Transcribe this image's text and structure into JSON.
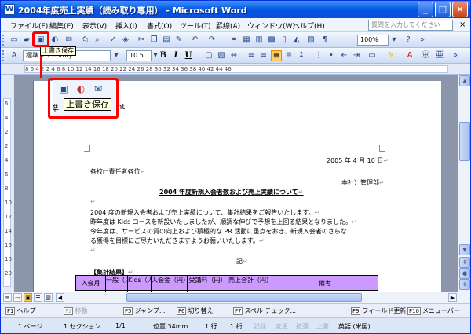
{
  "window": {
    "title": "2004年度売上実績（読み取り専用） - Microsoft Word",
    "minimize": "_",
    "maximize": "□",
    "close": "×"
  },
  "menubar": {
    "items": [
      "ファイル(F)",
      "編集(E)",
      "表示(V)",
      "挿入(I)",
      "書式(O)",
      "ツール(T)",
      "罫線(A)",
      "ウィンドウ(W)",
      "ヘルプ(H)"
    ],
    "help_placeholder": "質問を入力してください",
    "close": "×"
  },
  "toolbar_standard": {
    "zoom": "100%",
    "tooltip": "上書き保存"
  },
  "toolbar_format": {
    "style": "標準 + Century",
    "font_size": "10.5",
    "bold": "B",
    "italic": "I",
    "underline": "U"
  },
  "ruler": {
    "ticks": "8   6   4   2       2   4   6   8   10   12   14   16   18   20   22   24   26   28   30   32   34   36   38   40   42   44   46"
  },
  "vruler": {
    "ticks": [
      "6",
      "4",
      "2",
      "2",
      "4",
      "6",
      "8",
      "10",
      "12",
      "14",
      "16",
      "18",
      "20"
    ]
  },
  "zoom_callout": {
    "tooltip": "上書き保存",
    "partial_left": "準",
    "partial_right": "nt"
  },
  "document": {
    "date": "2005 年 4 月 10 日",
    "addressee": "各校□責任者各位",
    "sender": "本社〉管理部",
    "title": "2004 年度新規入会者数および売上実績について",
    "body": [
      "2004 度の新規入会者および売上実績について、集計結果をご報告いたします。",
      "昨年度は Kids コースを新設いたしましたが、順調な伸びで予想を上回る結果となりました。",
      "今年度は、サービスの質の向上および積極的な PR 活動に重点をおき、新規入会者のさらな",
      "る獲得を目標にご尽力いただきますようお願いいたします。"
    ],
    "ki": "記",
    "section": "【集計結果】",
    "table_headers": [
      "入会月",
      "一般（人）",
      "Kids（人）",
      "入会金（円）",
      "受講料（円）",
      "売上合計（円）",
      "備考"
    ],
    "para_mark": "↵"
  },
  "fkeys": [
    {
      "key": "F1",
      "label": "ヘルプ",
      "dim": false
    },
    {
      "key": "F2",
      "label": "移動",
      "dim": true
    },
    {
      "key": "F5",
      "label": "ジャンプ...",
      "dim": false
    },
    {
      "key": "F6",
      "label": "切り替え",
      "dim": false
    },
    {
      "key": "F7",
      "label": "スペル チェック...",
      "dim": false
    },
    {
      "key": "F9",
      "label": "フィールド更新",
      "dim": false
    },
    {
      "key": "F10",
      "label": "メニューバー",
      "dim": false
    }
  ],
  "status": {
    "page": "1 ページ",
    "section": "1 セクション",
    "pages": "1/1",
    "position": "位置 34mm",
    "line": "1 行",
    "column": "1 桁",
    "rec": "記録",
    "trk": "変更",
    "ext": "拡張",
    "ovr": "上書",
    "lang": "英語 (米国)"
  }
}
